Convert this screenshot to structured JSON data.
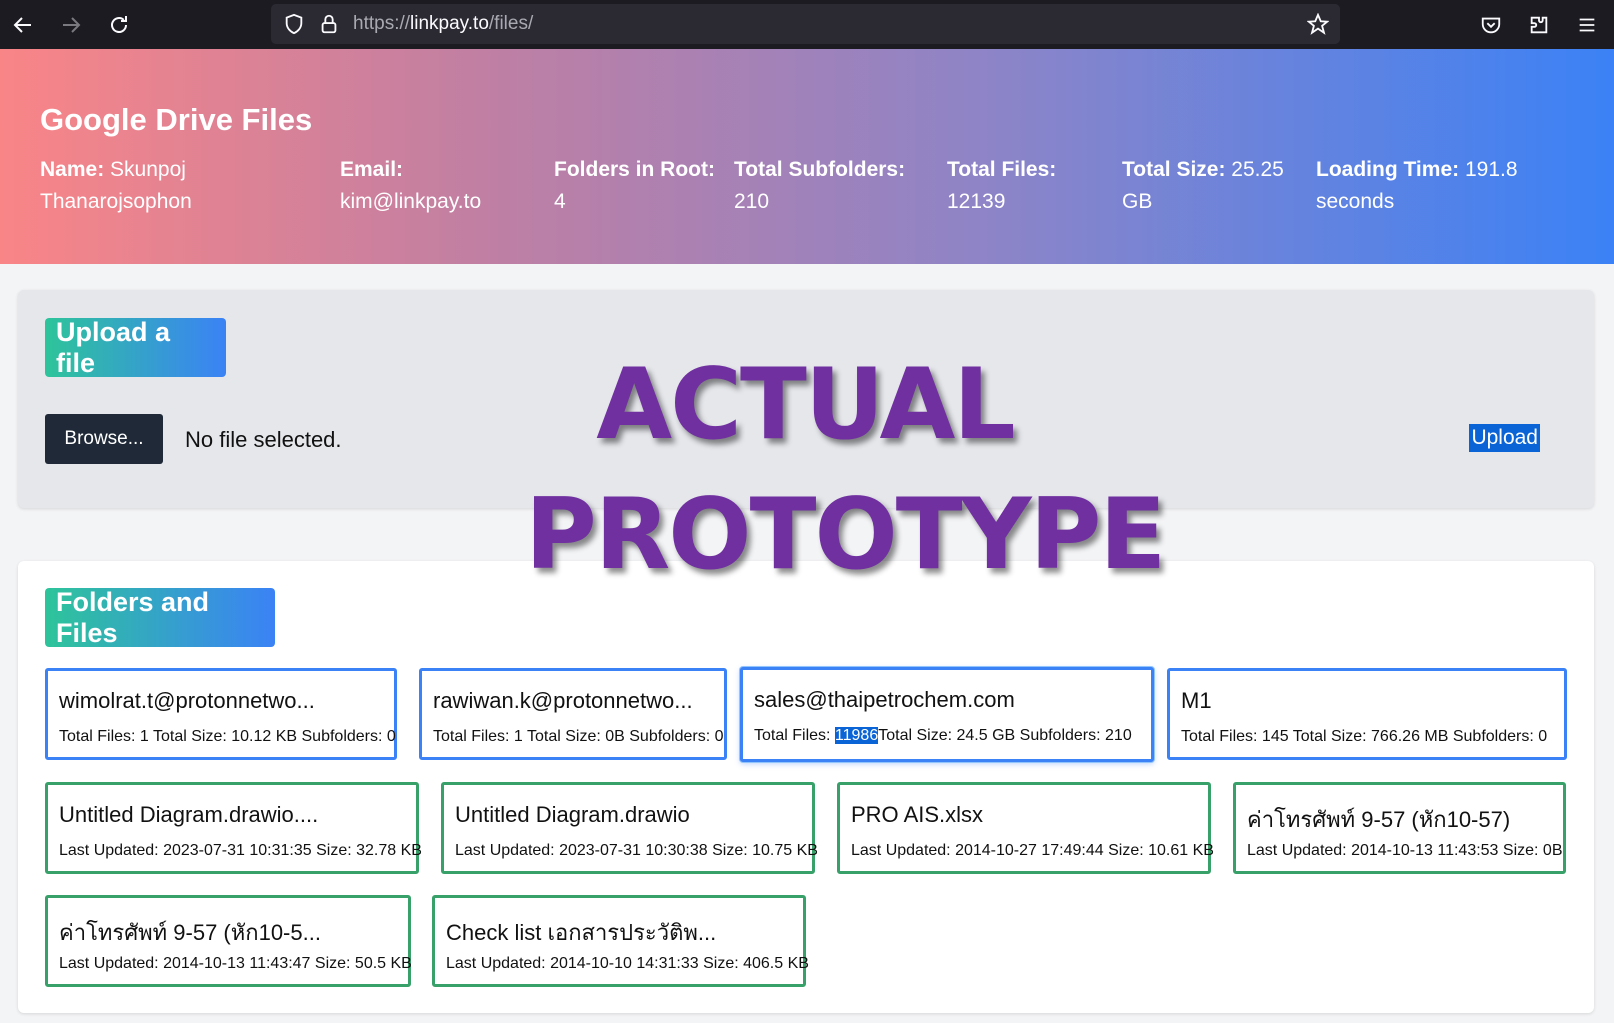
{
  "browser": {
    "url_prefix": "https://",
    "url_host": "linkpay.to",
    "url_path": "/files/",
    "icons": [
      "back-icon",
      "forward-icon",
      "reload-icon",
      "shield-icon",
      "lock-icon",
      "star-icon",
      "pocket-icon",
      "extensions-icon",
      "menu-icon"
    ]
  },
  "header": {
    "title": "Google Drive Files",
    "stats": [
      {
        "label": "Name:",
        "value": "Skunpoj",
        "value2": "Thanarojsophon"
      },
      {
        "label": "Email:",
        "value": "",
        "value2": "kim@linkpay.to"
      },
      {
        "label": "Folders in Root:",
        "value": "",
        "value2": "4"
      },
      {
        "label": "Total Subfolders:",
        "value": "",
        "value2": "210"
      },
      {
        "label": "Total Files:",
        "value": "",
        "value2": "12139"
      },
      {
        "label": "Total Size:",
        "value": "25.25",
        "value2": "GB"
      },
      {
        "label": "Loading Time:",
        "value": "191.8",
        "value2": "seconds"
      }
    ]
  },
  "upload": {
    "heading": "Upload a file",
    "browse_label": "Browse...",
    "status": "No file selected.",
    "upload_label": "Upload"
  },
  "watermark": {
    "line1": "ACTUAL",
    "line2": "PROTOTYPE"
  },
  "files": {
    "heading": "Folders and Files",
    "folders": [
      {
        "name": "wimolrat.t@protonnetwo...",
        "meta_pre": "Total Files: 1 Total Size: 10.12 KB Subfolders: 0",
        "sel": "",
        "meta_post": ""
      },
      {
        "name": "rawiwan.k@protonnetwo...",
        "meta_pre": "Total Files: 1 Total Size: 0B Subfolders: 0",
        "sel": "",
        "meta_post": ""
      },
      {
        "name": "sales@thaipetrochem.com",
        "meta_pre": "Total Files: ",
        "sel": "11986",
        "meta_post": "Total Size: 24.5 GB Subfolders: 210"
      },
      {
        "name": "M1",
        "meta_pre": "Total Files: 145 Total Size: 766.26 MB Subfolders: 0",
        "sel": "",
        "meta_post": ""
      }
    ],
    "items": [
      {
        "name": "Untitled Diagram.drawio....",
        "meta": "Last Updated: 2023-07-31 10:31:35 Size: 32.78 KB"
      },
      {
        "name": "Untitled Diagram.drawio",
        "meta": "Last Updated: 2023-07-31 10:30:38 Size: 10.75 KB"
      },
      {
        "name": "PRO AIS.xlsx",
        "meta": "Last Updated: 2014-10-27 17:49:44 Size: 10.61 KB"
      },
      {
        "name": "ค่าโทรศัพท์ 9-57 (หัก10-57)",
        "meta": "Last Updated: 2014-10-13 11:43:53 Size: 0B"
      },
      {
        "name": "ค่าโทรศัพท์ 9-57 (หัก10-5...",
        "meta": "Last Updated: 2014-10-13 11:43:47 Size: 50.5 KB"
      },
      {
        "name": "Check list เอกสารประวัติพ...",
        "meta": "Last Updated: 2014-10-10 14:31:33 Size: 406.5 KB"
      }
    ]
  }
}
